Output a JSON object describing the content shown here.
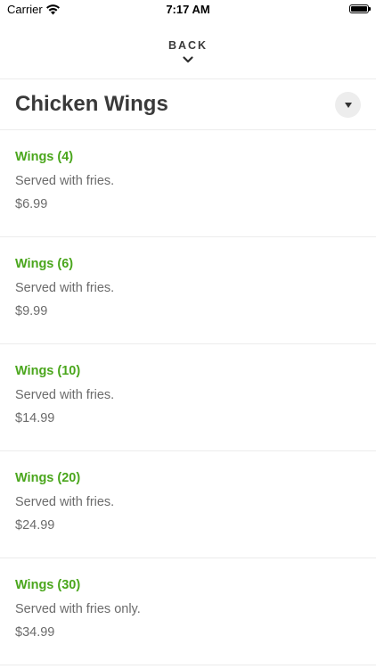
{
  "status_bar": {
    "carrier": "Carrier",
    "time": "7:17 AM"
  },
  "nav": {
    "back_label": "BACK"
  },
  "header": {
    "title": "Chicken Wings"
  },
  "items": [
    {
      "name": "Wings (4)",
      "description": "Served with fries.",
      "price": "$6.99"
    },
    {
      "name": "Wings (6)",
      "description": "Served with fries.",
      "price": "$9.99"
    },
    {
      "name": "Wings (10)",
      "description": "Served with fries.",
      "price": "$14.99"
    },
    {
      "name": "Wings (20)",
      "description": "Served with fries.",
      "price": "$24.99"
    },
    {
      "name": "Wings (30)",
      "description": "Served with fries only.",
      "price": "$34.99"
    }
  ],
  "colors": {
    "accent_green": "#4aa61c",
    "text_dark": "#3a3a3a",
    "text_muted": "#6b6b6b",
    "divider": "#ececec"
  },
  "icons": {
    "wifi": "wifi-icon",
    "battery": "battery-icon",
    "back": "chevron-down-icon",
    "dropdown": "triangle-down-icon"
  }
}
